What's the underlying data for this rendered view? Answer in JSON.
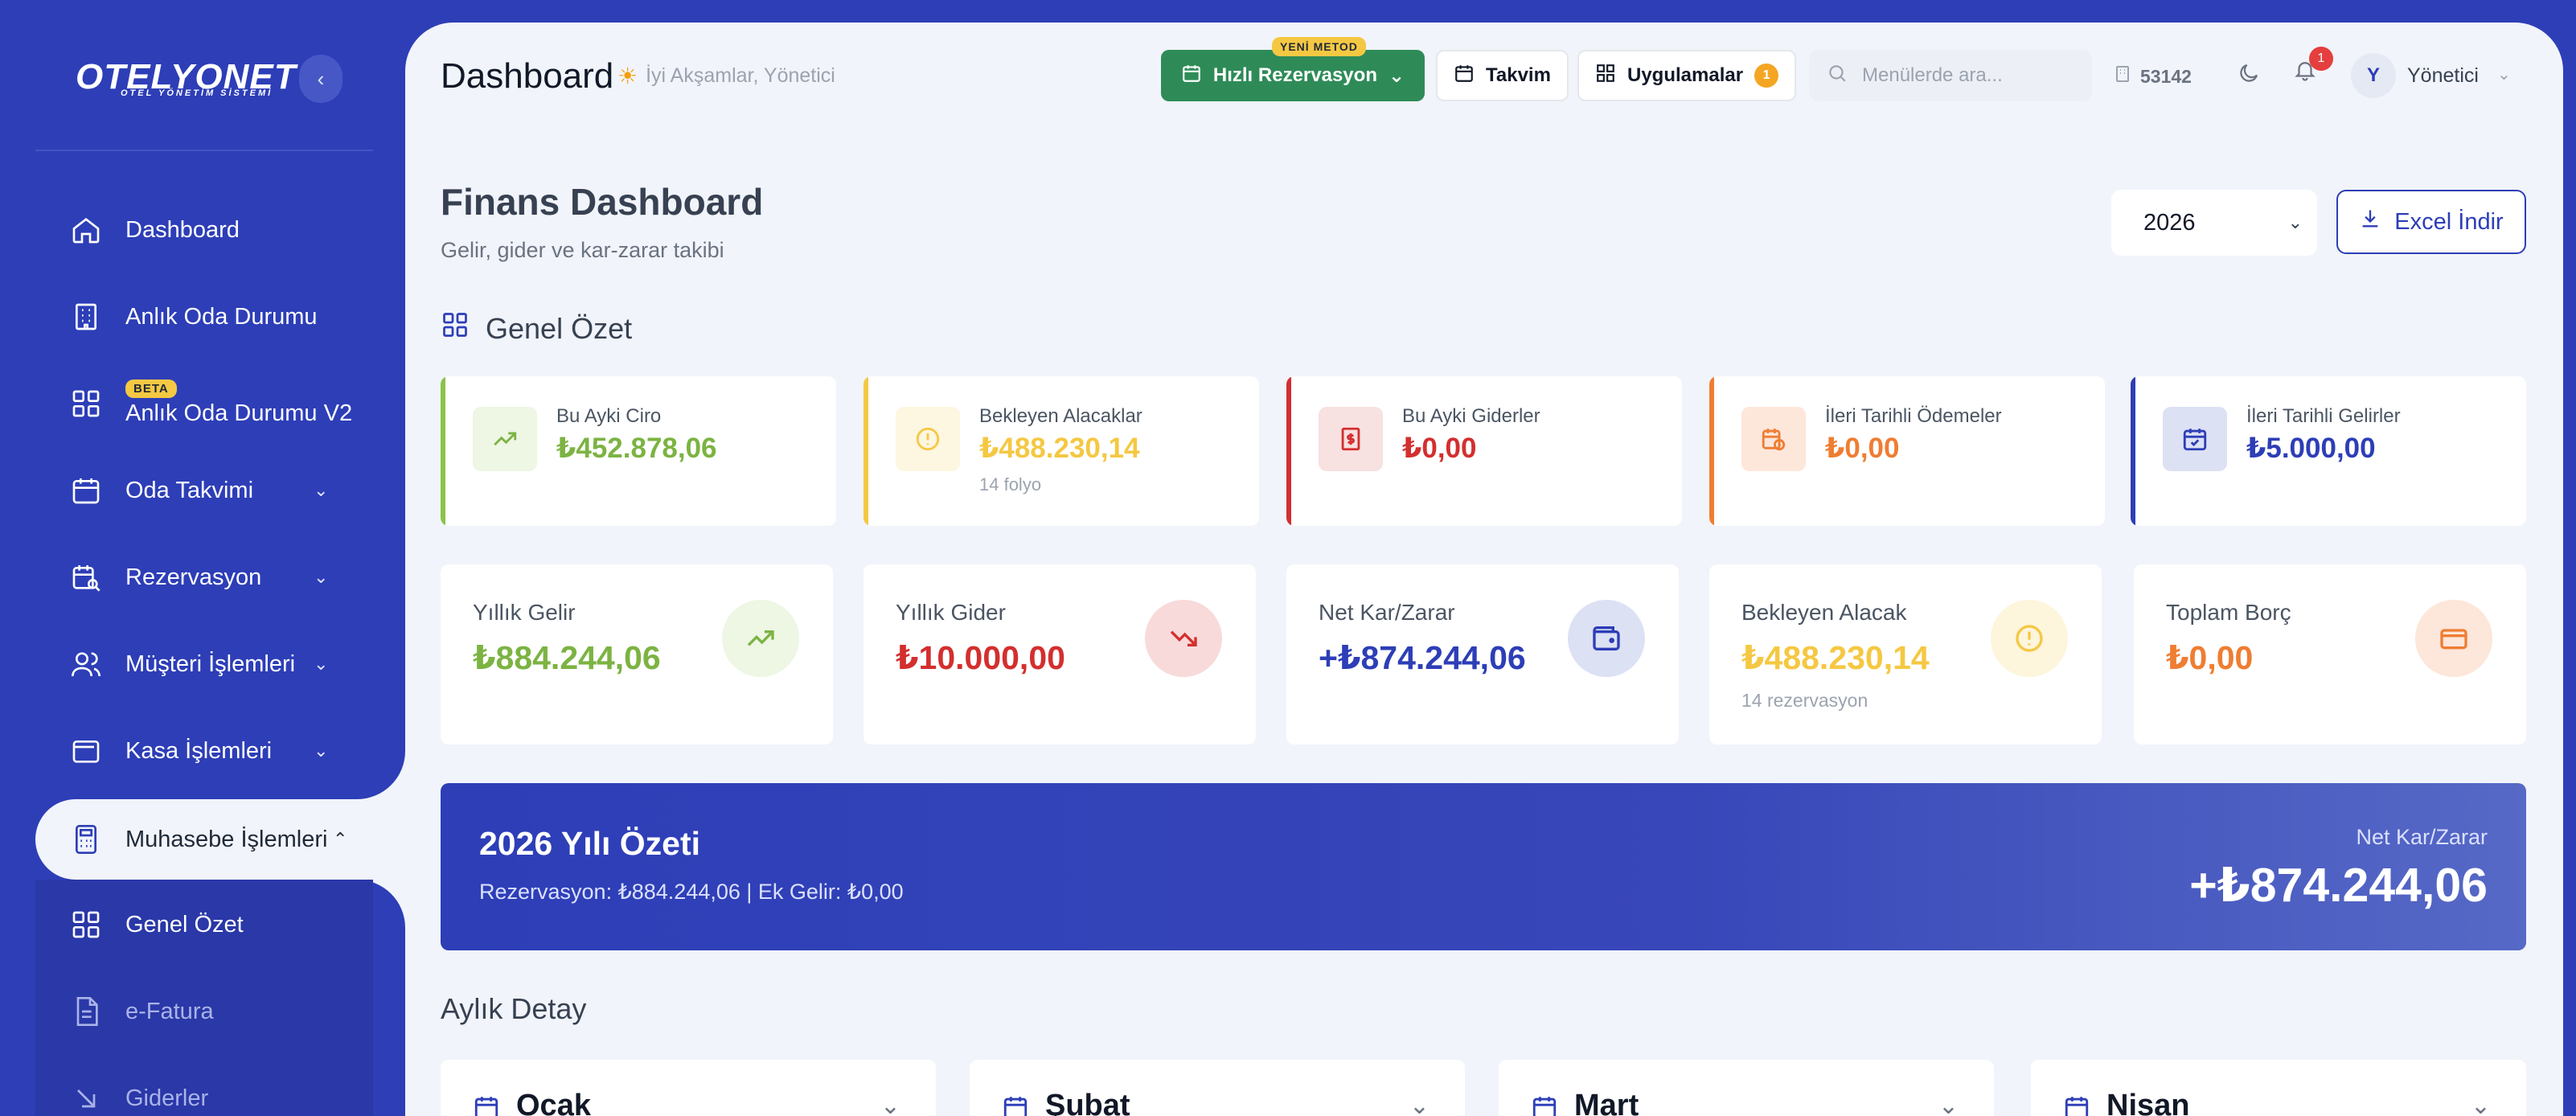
{
  "sidebar": {
    "logo": "OTELYONET",
    "logo_sub": "OTEL YÖNETİM SİSTEMİ",
    "collapse_icon": "chevron-left-icon",
    "items": [
      {
        "label": "Dashboard",
        "icon": "home-icon"
      },
      {
        "label": "Anlık Oda Durumu",
        "icon": "building-icon"
      },
      {
        "label": "Anlık Oda Durumu V2",
        "icon": "grid-icon",
        "badge": "BETA"
      },
      {
        "label": "Oda Takvimi",
        "icon": "calendar-icon"
      },
      {
        "label": "Rezervasyon",
        "icon": "calendar-search-icon"
      },
      {
        "label": "Müşteri İşlemleri",
        "icon": "users-icon"
      },
      {
        "label": "Kasa İşlemleri",
        "icon": "wallet-icon"
      },
      {
        "label": "Muhasebe İşlemleri",
        "icon": "calculator-icon"
      }
    ],
    "sub_items": [
      {
        "label": "Genel Özet",
        "icon": "grid-icon"
      },
      {
        "label": "e-Fatura",
        "icon": "document-icon"
      },
      {
        "label": "Giderler",
        "icon": "arrow-down-right-icon"
      }
    ]
  },
  "topbar": {
    "title": "Dashboard",
    "greeting": "İyi Akşamlar, Yönetici",
    "quick_badge": "YENİ METOD",
    "quick_label": "Hızlı Rezervasyon",
    "calendar_label": "Takvim",
    "apps_label": "Uygulamalar",
    "apps_count": "1",
    "search_placeholder": "Menülerde ara...",
    "hotel_id": "53142",
    "notif_count": "1",
    "avatar_letter": "Y",
    "user_name": "Yönetici"
  },
  "header": {
    "title": "Finans Dashboard",
    "subtitle": "Gelir, gider ve kar-zarar takibi",
    "year": "2026",
    "excel_label": "Excel İndir"
  },
  "summary": {
    "section_title": "Genel Özet",
    "cards": [
      {
        "label": "Bu Ayki Ciro",
        "value": "₺452.878,06",
        "sub": "",
        "color": "#7cb342"
      },
      {
        "label": "Bekleyen Alacaklar",
        "value": "₺488.230,14",
        "sub": "14 folyo",
        "color": "#f5c843"
      },
      {
        "label": "Bu Ayki Giderler",
        "value": "₺0,00",
        "sub": "",
        "color": "#d32f2f"
      },
      {
        "label": "İleri Tarihli Ödemeler",
        "value": "₺0,00",
        "sub": "",
        "color": "#ef7d32"
      },
      {
        "label": "İleri Tarihli Gelirler",
        "value": "₺5.000,00",
        "sub": "",
        "color": "#2d3eb7"
      }
    ]
  },
  "big_cards": [
    {
      "label": "Yıllık Gelir",
      "value": "₺884.244,06",
      "sub": "",
      "color": "#7cb342"
    },
    {
      "label": "Yıllık Gider",
      "value": "₺10.000,00",
      "sub": "",
      "color": "#d32f2f"
    },
    {
      "label": "Net Kar/Zarar",
      "value": "+₺874.244,06",
      "sub": "",
      "color": "#2d3eb7"
    },
    {
      "label": "Bekleyen Alacak",
      "value": "₺488.230,14",
      "sub": "14 rezervasyon",
      "color": "#f5c843"
    },
    {
      "label": "Toplam Borç",
      "value": "₺0,00",
      "sub": "",
      "color": "#ef7d32"
    }
  ],
  "banner": {
    "title": "2026 Yılı Özeti",
    "detail": "Rezervasyon: ₺884.244,06 | Ek Gelir: ₺0,00",
    "net_label": "Net Kar/Zarar",
    "net_value": "+₺874.244,06"
  },
  "monthly": {
    "title": "Aylık Detay",
    "months": [
      "Ocak",
      "Şubat",
      "Mart",
      "Nisan"
    ]
  }
}
